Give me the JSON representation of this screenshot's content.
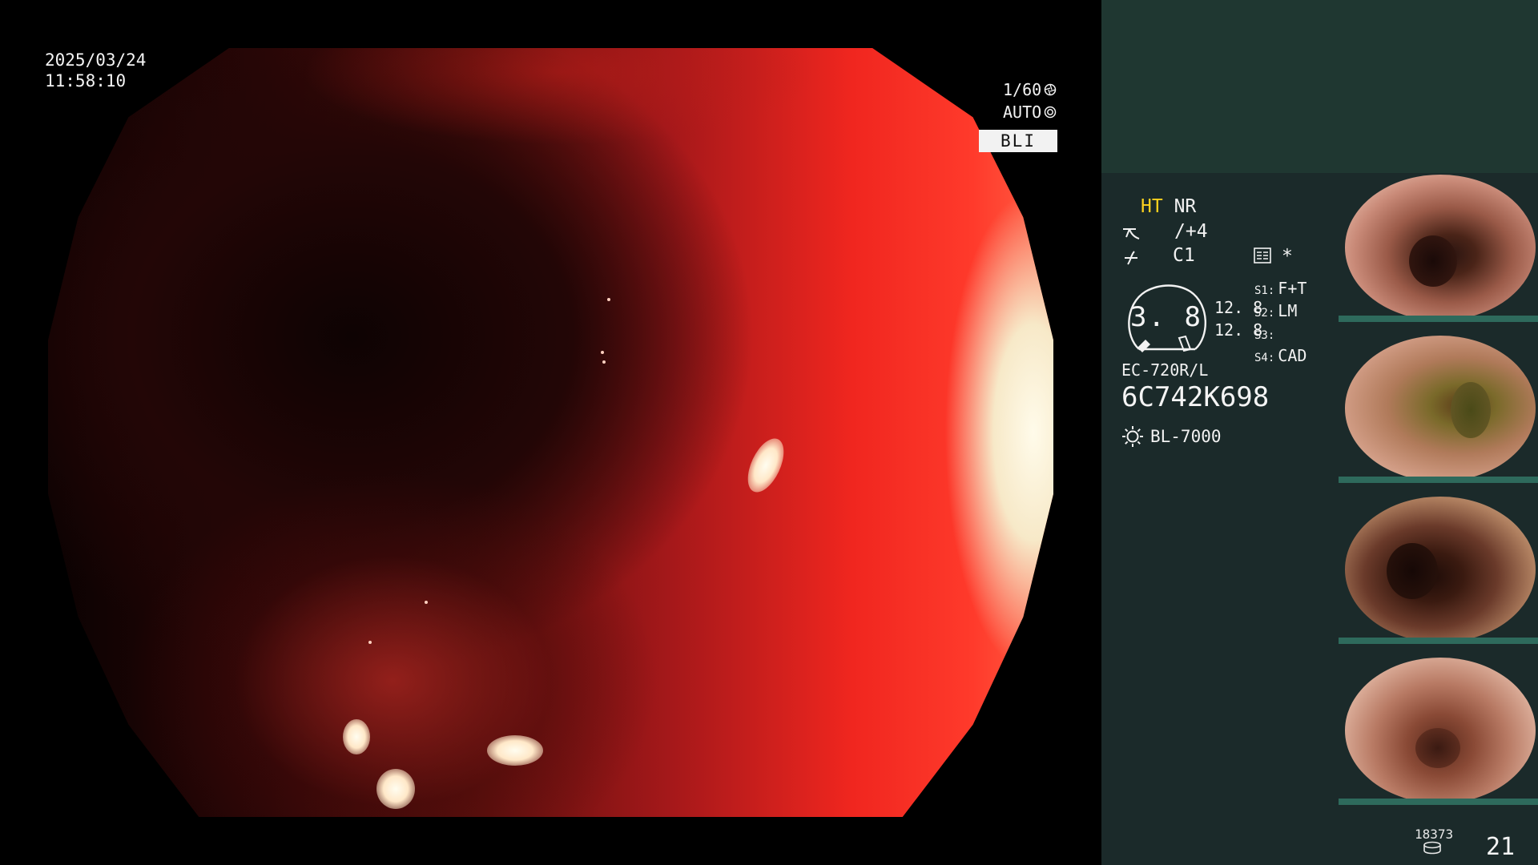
{
  "overlay": {
    "date": "2025/03/24",
    "time": "11:58:10",
    "shutter": "1/60",
    "iris": "AUTO",
    "mode": "BLI"
  },
  "panel": {
    "ht": "HT",
    "nr": "NR",
    "enhance": "/+4",
    "color": "C1",
    "asterisk": "*",
    "magnification": "3. 8",
    "zoom_values": [
      "12. 8",
      "12. 8"
    ],
    "switches": [
      {
        "key": "S1:",
        "value": "F+T"
      },
      {
        "key": "S2:",
        "value": "LM"
      },
      {
        "key": "S3:",
        "value": ""
      },
      {
        "key": "S4:",
        "value": "CAD"
      }
    ],
    "scope_model": "EC-720R/L",
    "serial": "6C742K698",
    "light_source": "BL-7000"
  },
  "status": {
    "storage_count": "18373",
    "image_count": "21"
  },
  "colors": {
    "accent_yellow": "#ffd21e",
    "panel_green": "#1f3731",
    "panel_dark": "#1b2a2a"
  }
}
